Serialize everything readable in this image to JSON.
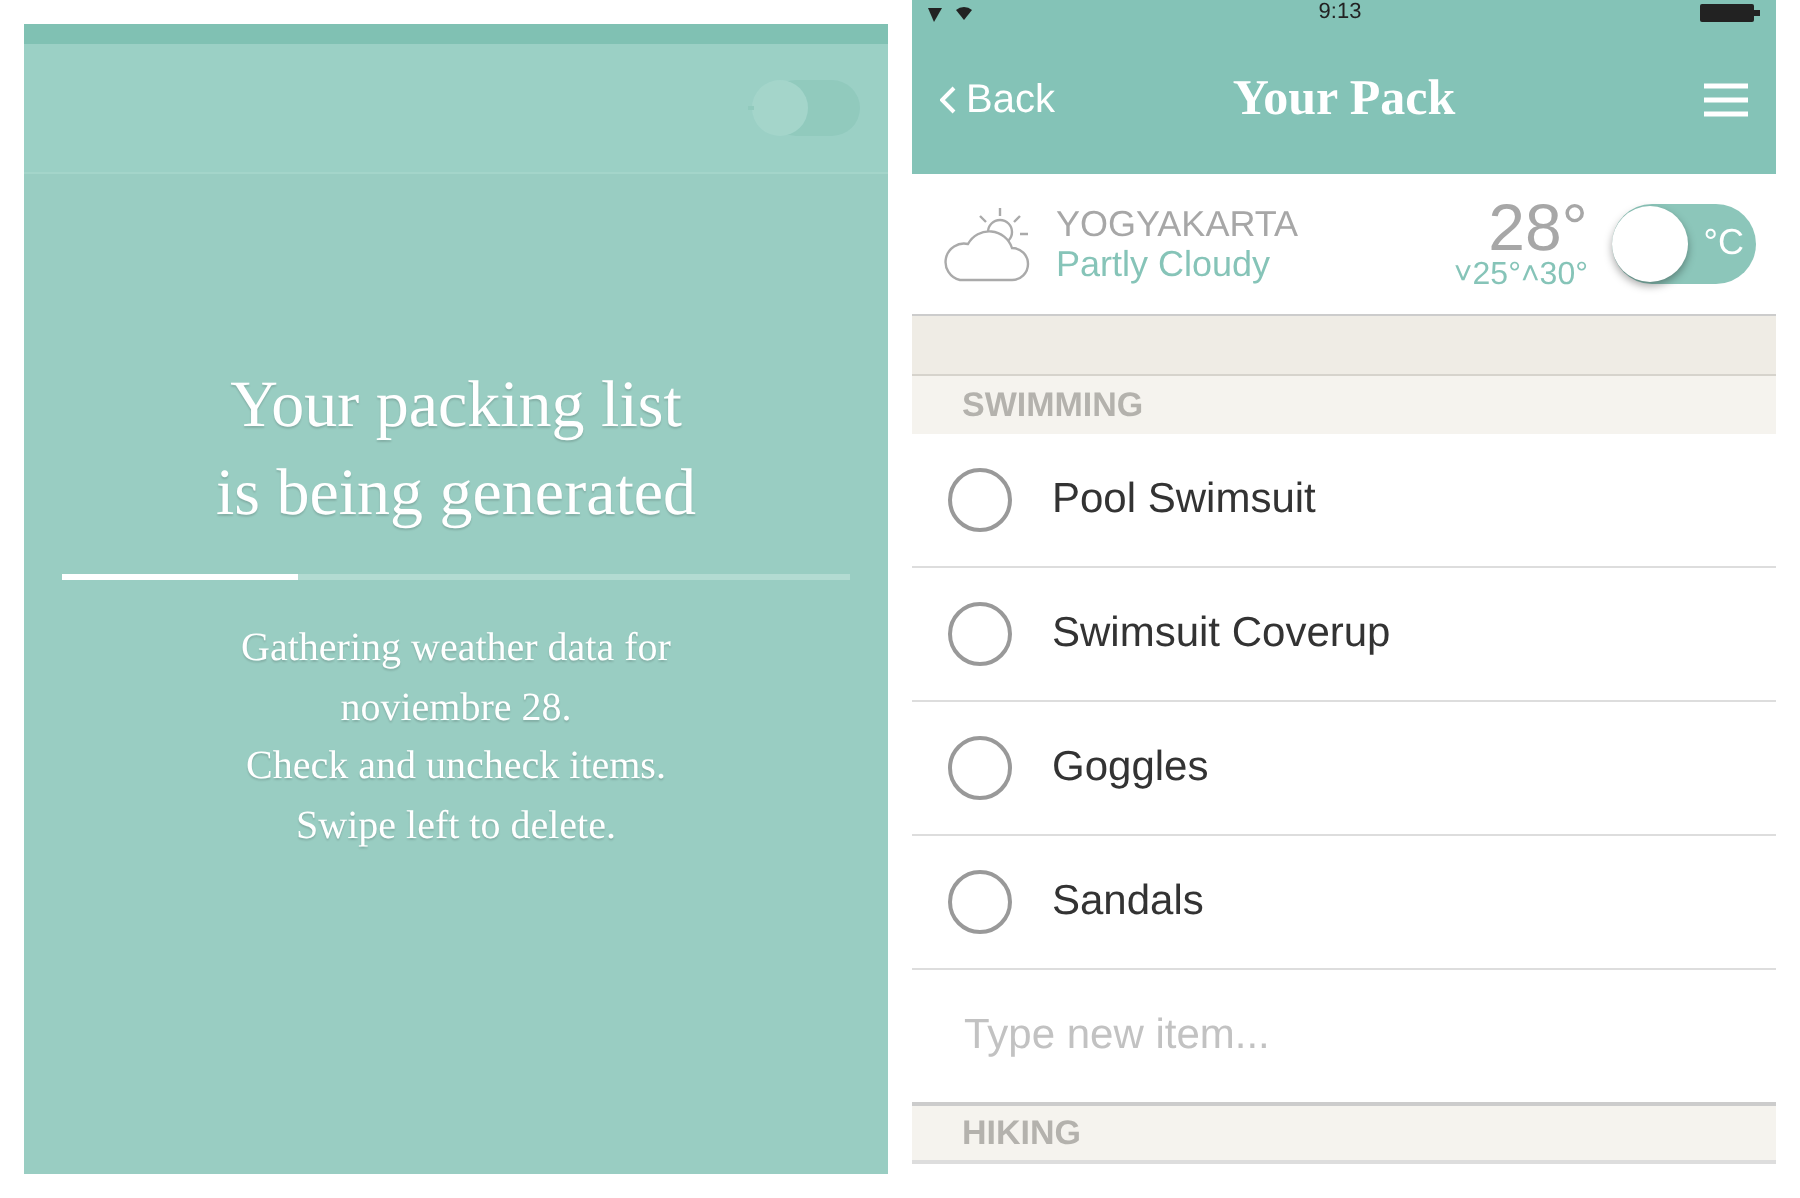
{
  "loading_screen": {
    "toggle": {
      "on": false
    },
    "title_lines": [
      "Your packing list",
      "is being generated"
    ],
    "progress": {
      "level": 0.3
    },
    "message_lines": [
      "Gathering weather data for",
      "noviembre 28.",
      "Check and uncheck items.",
      "Swipe left to delete."
    ]
  },
  "pack_screen": {
    "status_bar": {
      "time": "9:13"
    },
    "nav": {
      "back": "Back",
      "title": "Your Pack"
    },
    "weather": {
      "city": "YOGYAKARTA",
      "condition": "Partly Cloudy",
      "temperature": "28°",
      "range": "˅25°˄30°",
      "unit": "°C",
      "unit_switch_on": false
    },
    "sections": [
      {
        "title": "SWIMMING",
        "items": [
          {
            "label": "Pool Swimsuit",
            "checked": false
          },
          {
            "label": "Swimsuit Coverup",
            "checked": false
          },
          {
            "label": "Goggles",
            "checked": false
          },
          {
            "label": "Sandals",
            "checked": false
          }
        ],
        "new_item": {
          "placeholder": "Type new item..."
        }
      },
      {
        "title": "HIKING"
      }
    ]
  }
}
